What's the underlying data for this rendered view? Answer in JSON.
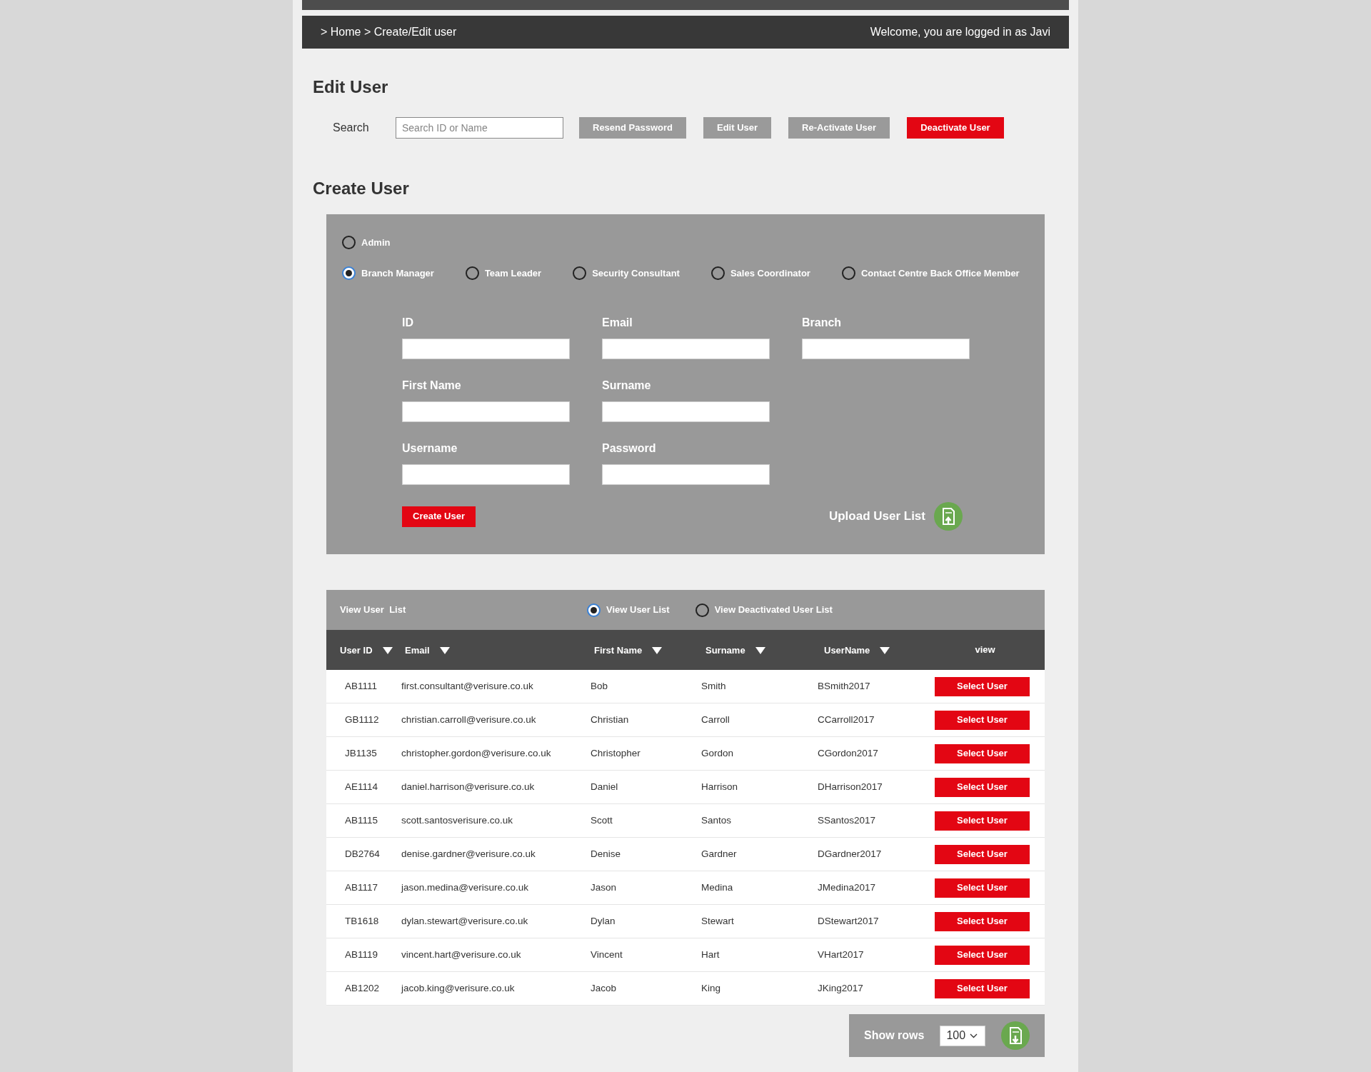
{
  "breadcrumb": "> Home > Create/Edit user",
  "welcome": "Welcome, you are logged in as Javi",
  "edit_user": {
    "title": "Edit User",
    "search_label": "Search",
    "search_placeholder": "Search ID or Name",
    "buttons": [
      {
        "label": "Resend Password",
        "kind": "secondary"
      },
      {
        "label": "Edit User",
        "kind": "secondary"
      },
      {
        "label": "Re-Activate User",
        "kind": "secondary"
      },
      {
        "label": "Deactivate User",
        "kind": "primary"
      }
    ]
  },
  "create_user": {
    "title": "Create User",
    "roles": [
      {
        "label": "Admin",
        "selected": false
      },
      {
        "label": "Branch Manager",
        "selected": true
      },
      {
        "label": "Team Leader",
        "selected": false
      },
      {
        "label": "Security Consultant",
        "selected": false
      },
      {
        "label": "Sales Coordinator",
        "selected": false
      },
      {
        "label": "Contact Centre Back Office Member",
        "selected": false
      }
    ],
    "fields": [
      {
        "label": "ID"
      },
      {
        "label": "Email"
      },
      {
        "label": "Branch"
      },
      {
        "label": "First Name"
      },
      {
        "label": "Surname"
      },
      {
        "label": "Username"
      },
      {
        "label": "Password"
      }
    ],
    "create_button": "Create User",
    "upload_label": "Upload User List"
  },
  "user_list": {
    "title": "View User  List",
    "views": [
      {
        "label": "View User List",
        "selected": true
      },
      {
        "label": "View Deactivated User List",
        "selected": false
      }
    ],
    "columns": [
      {
        "label": "User ID",
        "sortable": true
      },
      {
        "label": "Email",
        "sortable": true
      },
      {
        "label": "First Name",
        "sortable": true
      },
      {
        "label": "Surname",
        "sortable": true
      },
      {
        "label": "UserName",
        "sortable": true
      },
      {
        "label": "view",
        "sortable": false
      }
    ],
    "rows": [
      [
        "AB1111",
        "first.consultant@verisure.co.uk",
        "Bob",
        "Smith",
        "BSmith2017",
        "Select User"
      ],
      [
        "GB1112",
        "christian.carroll@verisure.co.uk",
        "Christian",
        "Carroll",
        "CCarroll2017",
        "Select User"
      ],
      [
        "JB1135",
        "christopher.gordon@verisure.co.uk",
        "Christopher",
        "Gordon",
        "CGordon2017",
        "Select User"
      ],
      [
        "AE1114",
        "daniel.harrison@verisure.co.uk",
        "Daniel",
        "Harrison",
        "DHarrison2017",
        "Select User"
      ],
      [
        "AB1115",
        "scott.santosverisure.co.uk",
        "Scott",
        "Santos",
        "SSantos2017",
        "Select User"
      ],
      [
        "DB2764",
        "denise.gardner@verisure.co.uk",
        "Denise",
        "Gardner",
        "DGardner2017",
        "Select User"
      ],
      [
        "AB1117",
        "jason.medina@verisure.co.uk",
        "Jason",
        "Medina",
        "JMedina2017",
        "Select User"
      ],
      [
        "TB1618",
        "dylan.stewart@verisure.co.uk",
        "Dylan",
        "Stewart",
        "DStewart2017",
        "Select User"
      ],
      [
        "AB1119",
        "vincent.hart@verisure.co.uk",
        "Vincent",
        "Hart",
        "VHart2017",
        "Select User"
      ],
      [
        "AB1202",
        "jacob.king@verisure.co.uk",
        "Jacob",
        "King",
        "JKing2017",
        "Select User"
      ]
    ],
    "show_rows_label": "Show rows",
    "show_rows_value": "100"
  }
}
